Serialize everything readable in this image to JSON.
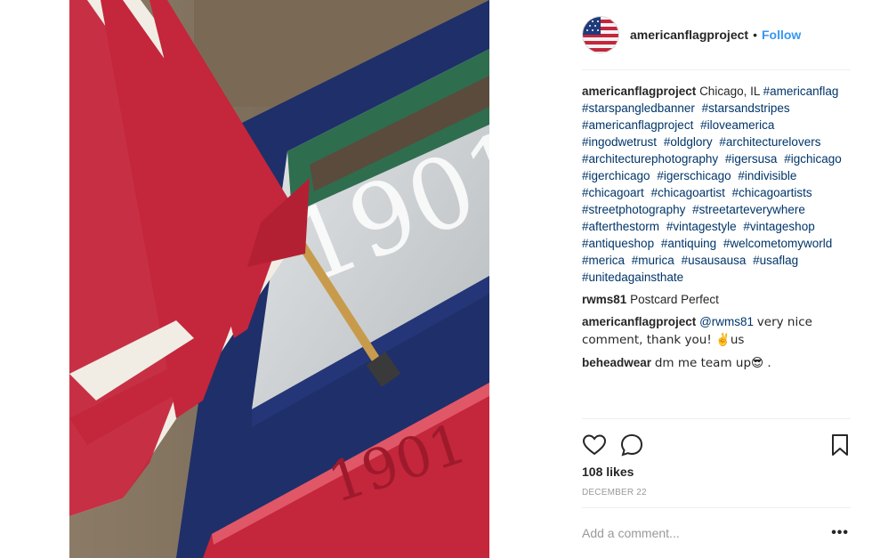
{
  "post": {
    "username": "americanflagproject",
    "follow_label": "Follow",
    "separator": "•",
    "image_text": "1901",
    "image_sign_text": "1901"
  },
  "caption": {
    "username": "americanflagproject",
    "location": "Chicago, IL",
    "hashtags": [
      "#americanflag",
      "#starspangledbanner",
      "#starsandstripes",
      "#americanflagproject",
      "#iloveamerica",
      "#ingodwetrust",
      "#oldglory",
      "#architecturelovers",
      "#architecturephotography",
      "#igersusa",
      "#igchicago",
      "#igerchicago",
      "#igerschicago",
      "#indivisible",
      "#chicagoart",
      "#chicagoartist",
      "#chicagoartists",
      "#streetphotography",
      "#streetarteverywhere",
      "#afterthestorm",
      "#vintagestyle",
      "#vintageshop",
      "#antiqueshop",
      "#antiquing",
      "#welcometomyworld",
      "#merica",
      "#murica",
      "#usausausa",
      "#usaflag",
      "#unitedagainsthate"
    ]
  },
  "comments": [
    {
      "user": "rwms81",
      "text": "Postcard Perfect"
    },
    {
      "user": "americanflagproject",
      "mention": "@rwms81",
      "text": "very nice comment, thank you! ✌️us"
    },
    {
      "user": "beheadwear",
      "text": "dm me team up😎 ."
    }
  ],
  "stats": {
    "likes": "108 likes",
    "date": "DECEMBER 22"
  },
  "add_comment": {
    "placeholder": "Add a comment...",
    "more_label": "•••"
  },
  "icons": {
    "like": "heart-icon",
    "comment": "comment-bubble-icon",
    "save": "bookmark-icon"
  }
}
